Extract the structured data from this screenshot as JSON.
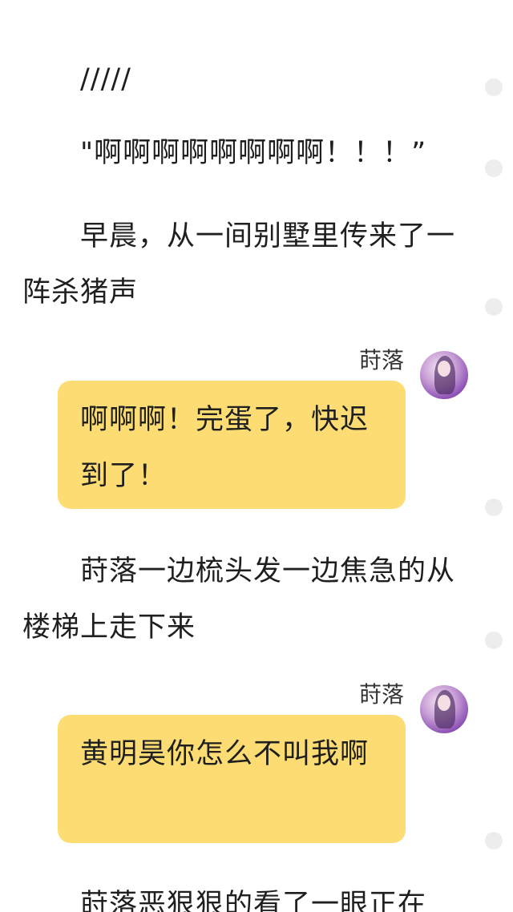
{
  "paragraphs": [
    "/////",
    "\"啊啊啊啊啊啊啊啊！！！”",
    "早晨，从一间别墅里传来了一阵杀猪声",
    "莳落一边梳头发一边焦急的从楼梯上走下来",
    "莳落恶狠狠的看了一眼正在"
  ],
  "messages": [
    {
      "speaker": "莳落",
      "avatar": "avatar-portrait",
      "text": "啊啊啊！完蛋了，快迟到了！"
    },
    {
      "speaker": "莳落",
      "avatar": "avatar-portrait",
      "text": "黄明昊你怎么不叫我啊"
    }
  ],
  "colors": {
    "bubble": "#fcdc73",
    "text": "#1f1f1f",
    "background": "#ffffff",
    "scroll_dot": "#ededed"
  }
}
